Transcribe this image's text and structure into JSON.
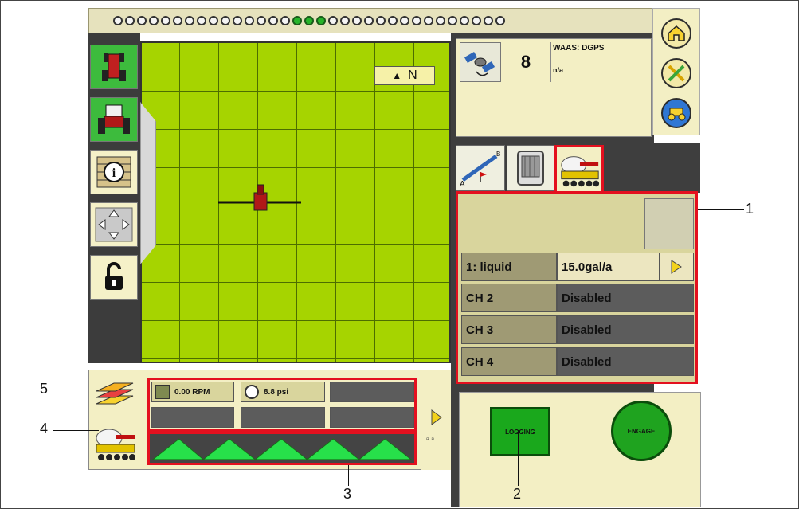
{
  "lightbar": {
    "led_count_left": 15,
    "led_count_center": 3,
    "led_count_right": 15
  },
  "map": {
    "north_label": "N"
  },
  "gps": {
    "satellites": "8",
    "signal": "WAAS: DGPS",
    "value": "n/a"
  },
  "product": {
    "rows": [
      {
        "channel": "1: liquid",
        "value": "15.0gal/a"
      },
      {
        "channel": "CH 2",
        "value": "Disabled"
      },
      {
        "channel": "CH 3",
        "value": "Disabled"
      },
      {
        "channel": "CH 4",
        "value": "Disabled"
      }
    ]
  },
  "stats": {
    "rpm": "0.00 RPM",
    "pressure": "8.8 psi"
  },
  "buttons": {
    "logging": "LOGGING",
    "engage": "ENGAGE"
  },
  "callouts": {
    "c1": "1",
    "c2": "2",
    "c3": "3",
    "c4": "4",
    "c5": "5"
  },
  "colors": {
    "map_green": "#a6d400",
    "highlight_red": "#e4101f",
    "panel_cream": "#f3efc4",
    "button_green": "#1aa81c"
  }
}
